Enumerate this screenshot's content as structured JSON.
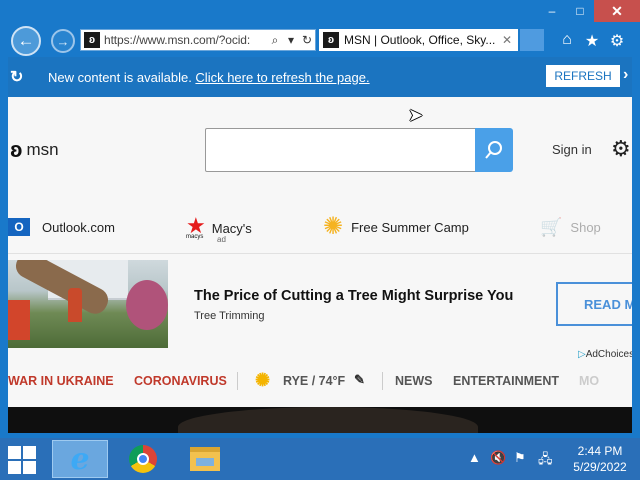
{
  "browser": {
    "address_url": "https://www.msn.com/?ocid:",
    "tab_title": "MSN | Outlook, Office, Sky...",
    "back_symbol": "←",
    "forward_symbol": "→",
    "address_icons": {
      "search": "⌕",
      "dropdown": "▾",
      "refresh": "↻"
    },
    "tab_close_symbol": "✕",
    "toolbar_icons": {
      "home": "⌂",
      "favorites": "★",
      "tools": "⚙"
    },
    "window_controls": {
      "minimize": "‒",
      "maximize": "□",
      "close": "✕"
    }
  },
  "notice": {
    "refresh_symbol": "↻",
    "text": "New content is available. ",
    "link": "Click here to refresh the page.",
    "button": "REFRESH",
    "chevron_symbol": "›"
  },
  "header": {
    "logo_symbol": "ʚ",
    "logo_text": "msn",
    "search_placeholder": "",
    "search_symbol": "⌕",
    "sign_in": "Sign in",
    "settings_symbol": "⚙"
  },
  "quick_links": [
    {
      "label": "Outlook.com",
      "icon_glyph": "O"
    },
    {
      "label": "Macy's",
      "icon_glyph": "★",
      "sublabel": "ad",
      "brand": "macys"
    },
    {
      "label": "Free Summer Camp",
      "icon_glyph": "✺"
    },
    {
      "label": "Shop",
      "icon_glyph": "🛒"
    }
  ],
  "ad": {
    "title": "The Price of Cutting a Tree Might Surprise You",
    "subtitle": "Tree Trimming",
    "cta": "READ M",
    "adchoices_symbol": "▷",
    "adchoices": "AdChoices"
  },
  "topics": {
    "items": [
      "WAR IN UKRAINE",
      "CORONAVIRUS"
    ],
    "sun_symbol": "✺",
    "weather": "RYE / 74°F",
    "pencil_symbol": "✎",
    "sections": [
      "NEWS",
      "ENTERTAINMENT",
      "MO"
    ]
  },
  "taskbar": {
    "time": "2:44 PM",
    "date": "5/29/2022",
    "ie_glyph": "e",
    "tray": {
      "chevron": "▲",
      "volume": "🔇",
      "flag": "⚑",
      "network": "🖧"
    }
  },
  "colors": {
    "accent": "#1979ca",
    "notice_bar": "#1b74c0",
    "search_button": "#4aa0e8",
    "topic_red": "#c0392b",
    "taskbar": "#2a6fb8"
  }
}
